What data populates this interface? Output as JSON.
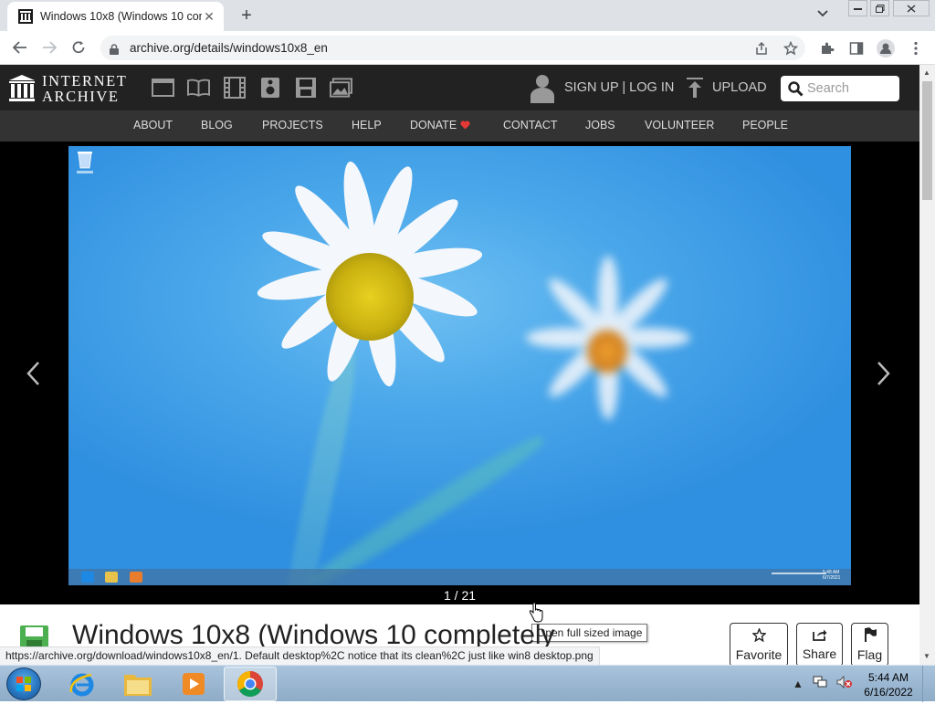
{
  "browser": {
    "tab_title": "Windows 10x8 (Windows 10 com",
    "url": "archive.org/details/windows10x8_en",
    "status_url": "https://archive.org/download/windows10x8_en/1. Default desktop%2C notice that its clean%2C just like win8 desktop.png"
  },
  "ia_header": {
    "logo_line1": "INTERNET",
    "logo_line2": "ARCHIVE",
    "signup": "SIGN UP | LOG IN",
    "upload": "UPLOAD",
    "search_placeholder": "Search",
    "nav": [
      "ABOUT",
      "BLOG",
      "PROJECTS",
      "HELP",
      "DONATE",
      "CONTACT",
      "JOBS",
      "VOLUNTEER",
      "PEOPLE"
    ],
    "media_icons": [
      "web-icon",
      "texts-icon",
      "video-icon",
      "audio-icon",
      "software-icon",
      "images-icon"
    ]
  },
  "viewer": {
    "counter": "1 / 21",
    "tooltip": "Open full sized image",
    "desktop_clock": "5:48 AM\n6/7/2021"
  },
  "item": {
    "title": "Windows 10x8 (Windows 10 completely",
    "actions": {
      "favorite": "Favorite",
      "share": "Share",
      "flag": "Flag"
    }
  },
  "taskbar": {
    "time": "5:44 AM",
    "date": "6/16/2022",
    "apps": [
      "internet-explorer",
      "file-explorer",
      "media-player",
      "chrome"
    ]
  },
  "colors": {
    "ia_header": "#222222",
    "ia_nav": "#333333",
    "donate_heart": "#e53935",
    "desktop_blue": "#4aa7ea"
  }
}
